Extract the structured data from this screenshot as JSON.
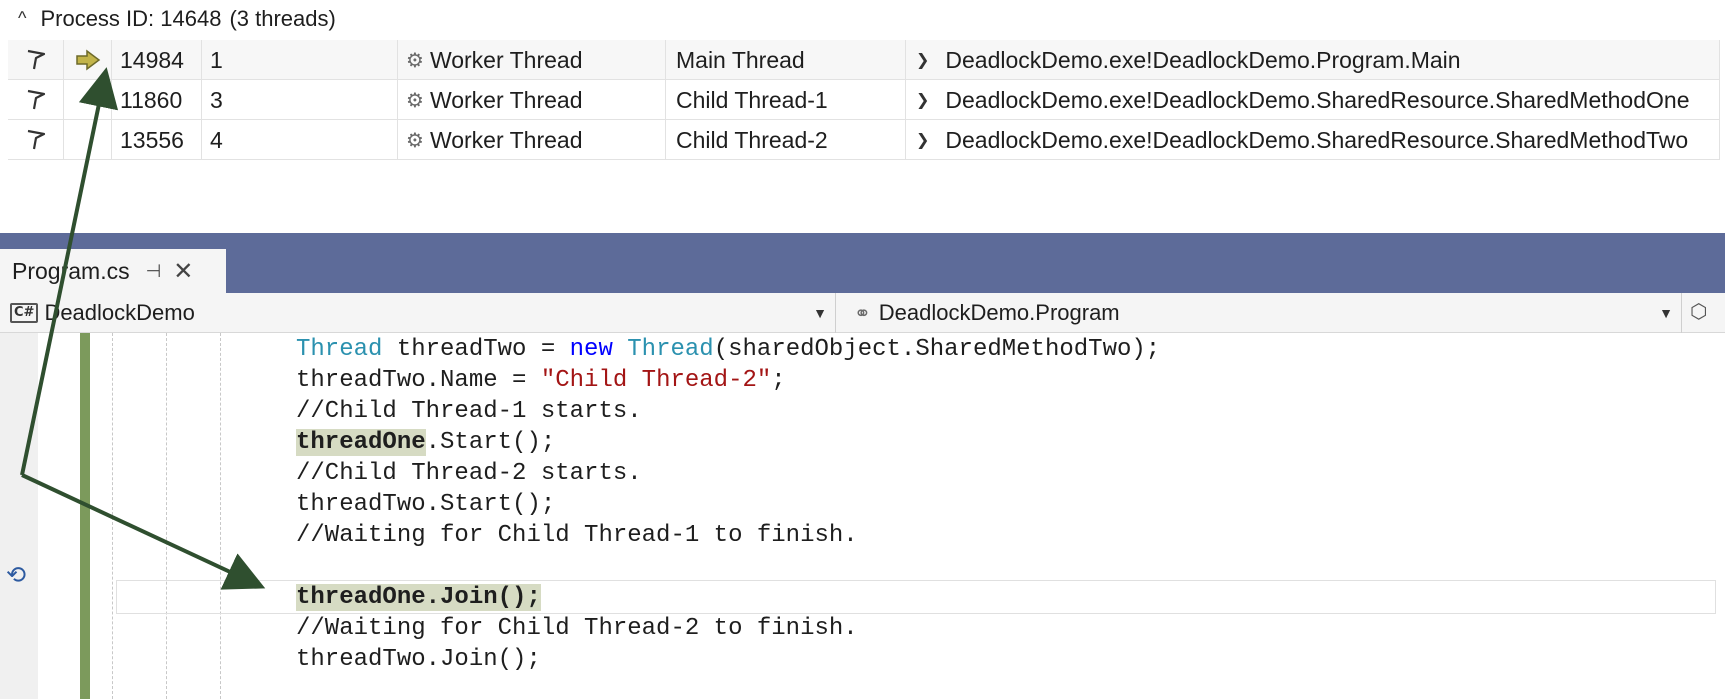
{
  "threads_window": {
    "process_header": {
      "label": "Process ID: 14648",
      "thread_count": "(3 threads)"
    },
    "rows": [
      {
        "id": "14984",
        "managed_id": "1",
        "category": "Worker Thread",
        "name": "Main Thread",
        "location": "DeadlockDemo.exe!DeadlockDemo.Program.Main",
        "current": true
      },
      {
        "id": "11860",
        "managed_id": "3",
        "category": "Worker Thread",
        "name": "Child Thread-1",
        "location": "DeadlockDemo.exe!DeadlockDemo.SharedResource.SharedMethodOne",
        "current": false
      },
      {
        "id": "13556",
        "managed_id": "4",
        "category": "Worker Thread",
        "name": "Child Thread-2",
        "location": "DeadlockDemo.exe!DeadlockDemo.SharedResource.SharedMethodTwo",
        "current": false
      }
    ]
  },
  "editor": {
    "tab": {
      "label": "Program.cs",
      "pin_glyph": "⊣",
      "close_glyph": "✕"
    },
    "nav": {
      "project": "DeadlockDemo",
      "project_badge": "C#",
      "type": "DeadlockDemo.Program"
    },
    "code": {
      "line1": {
        "t1": "Thread",
        "t2": " threadTwo = ",
        "t3": "new",
        "t4": " ",
        "t5": "Thread",
        "t6": "(sharedObject.SharedMethodTwo);"
      },
      "line2": {
        "t1": "threadTwo.Name = ",
        "t2": "\"Child Thread-2\"",
        "t3": ";"
      },
      "line3": "//Child Thread-1 starts.",
      "line4": {
        "t1": "threadOne",
        "t2": ".Start();"
      },
      "line5": "//Child Thread-2 starts.",
      "line6": "threadTwo.Start();",
      "line7": "//Waiting for Child Thread-1 to finish.",
      "line8": "threadOne.Join();",
      "line9": "//Waiting for Child Thread-2 to finish.",
      "line10": "threadTwo.Join();"
    }
  },
  "colors": {
    "tabstrip": "#5d6b99",
    "change_bar": "#7c9a5c",
    "current_statement": "#d6dbc3",
    "annotation_arrow": "#2f4f2f"
  },
  "icons": {
    "flag": "flag-icon",
    "current_thread": "current-thread-arrow-icon",
    "worker": "gears-icon",
    "location_dropdown": "chevron-down-icon",
    "thread_marker": "thread-marker-icon"
  }
}
